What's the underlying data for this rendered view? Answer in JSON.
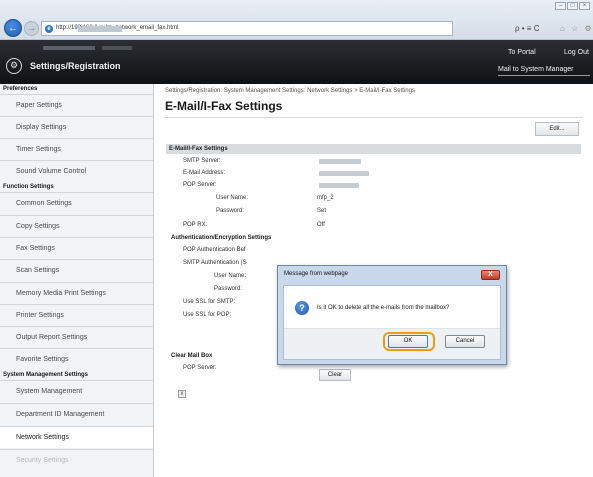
{
  "browser": {
    "url": "http://192.168.1.xx/m_network_email_fax.html",
    "back_glyph": "←",
    "forward_glyph": "→",
    "window_controls": [
      "–",
      "□",
      "×"
    ],
    "toolbar_icons_text": "ρ • ≡ C",
    "toolbar_icons_text2": "⌂ ☆ ⚙"
  },
  "header": {
    "app_title": "Settings/Registration",
    "to_portal": "To Portal",
    "log_out": "Log Out",
    "mail_link": "Mail to System Manager"
  },
  "sidebar": {
    "cat_preferences": "Preferences",
    "cat_function": "Function Settings",
    "cat_system": "System Management Settings",
    "preferences": [
      "Paper Settings",
      "Display Settings",
      "Timer Settings",
      "Sound Volume Control"
    ],
    "function": [
      "Common Settings",
      "Copy Settings",
      "Fax Settings",
      "Scan Settings",
      "Memory Media Print Settings",
      "Printer Settings",
      "Output Report Settings",
      "Favorite Settings"
    ],
    "system": [
      "System Management",
      "Department ID Management",
      "Network Settings",
      "Security Settings"
    ]
  },
  "main": {
    "breadcrumb": "Settings/Registration: System Management Settings: Network Settings > E-Mail/I-Fax Settings",
    "title": "E-Mail/I-Fax Settings",
    "edit_label": "Edit...",
    "section_email": "E-Mail/I-Fax Settings",
    "smtp_server": "SMTP Server:",
    "email_address": "E-Mail Address:",
    "pop_server": "POP Server:",
    "user_name": "User Name:",
    "user_name_value": "mfp_2",
    "password": "Password:",
    "password_value": "Set",
    "pop_rx": "POP RX:",
    "pop_rx_value": "Off",
    "section_auth": "Authentication/Encryption Settings",
    "pop_auth_before": "POP Authentication Bef",
    "smtp_auth": "SMTP Authentication (S",
    "user_name_2": "User Name:",
    "password_2": "Password:",
    "ssl_smtp": "Use SSL for SMTP:",
    "ssl_pop": "Use SSL for POP:",
    "section_clear": "Clear Mail Box",
    "pop_server_2": "POP Server:",
    "clear_label": "Clear",
    "mini_icon_glyph": "x"
  },
  "dialog": {
    "title": "Message from webpage",
    "close_glyph": "X",
    "question_glyph": "?",
    "message": "Is it OK to delete all the e-mails from the mailbox?",
    "ok_label": "OK",
    "cancel_label": "Cancel"
  },
  "colors": {
    "highlight_ring": "#f39c12",
    "header_bg": "#1a1c1f",
    "dialog_frame": "#c9d8ea"
  }
}
